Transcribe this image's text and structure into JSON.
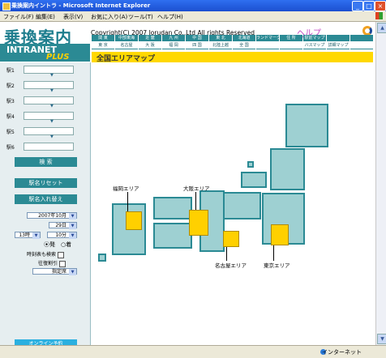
{
  "window": {
    "title": "乗換案内イントラ - Microsoft Internet Explorer",
    "controls": [
      "_",
      "□",
      "×"
    ]
  },
  "menu": [
    "ファイル(F)",
    "編集(E)",
    "表示(V)",
    "お気に入り(A)",
    "ツール(T)",
    "ヘルプ(H)"
  ],
  "header": {
    "logo_main": "乗換案内",
    "logo_intranet": "INTRANET",
    "logo_plus": "PLUS",
    "copyright": "Copyright(C) 2007 Jorudan Co.,Ltd All rights Reserved",
    "help": "ヘルプ",
    "nav_row1": [
      "関 東",
      "中部東海",
      "近 畿",
      "九 州",
      "中 国",
      "東 北",
      "北海道",
      "ランドマーク",
      "住 所",
      "駅前マップ"
    ],
    "nav_row2": [
      "東 京",
      "名古屋",
      "大 阪",
      "福 岡",
      "四 国",
      "北陸上越",
      "全 国",
      "バスマップ",
      "詳細マップ"
    ]
  },
  "area_bar": {
    "title": "全国エリアマップ"
  },
  "sidebar": {
    "stations": [
      "駅1",
      "駅2",
      "駅3",
      "駅4",
      "駅5",
      "駅6"
    ],
    "search_button": "検 索",
    "reset_button": "駅名リセット",
    "swap_button": "駅名入れ替え",
    "date": {
      "month": "2007年10月",
      "day": "29日",
      "hour": "13時",
      "minute": "10分"
    },
    "radio": {
      "depart": "発",
      "arrive": "着"
    },
    "options": {
      "time_search": "時刻表も検索",
      "round_trip": "往復割引"
    },
    "seat": "指定席",
    "online_button": "オンライン予約"
  },
  "map": {
    "labels": {
      "fukuoka": "福岡エリア",
      "osaka": "大阪エリア",
      "nagoya": "名古屋エリア",
      "tokyo": "東京エリア"
    }
  },
  "status": {
    "zone": "インターネット"
  },
  "colors": {
    "teal": "#2b8a94",
    "map_fill": "#9ed0d2",
    "highlight": "#ffd000",
    "banner": "#ffd800"
  }
}
